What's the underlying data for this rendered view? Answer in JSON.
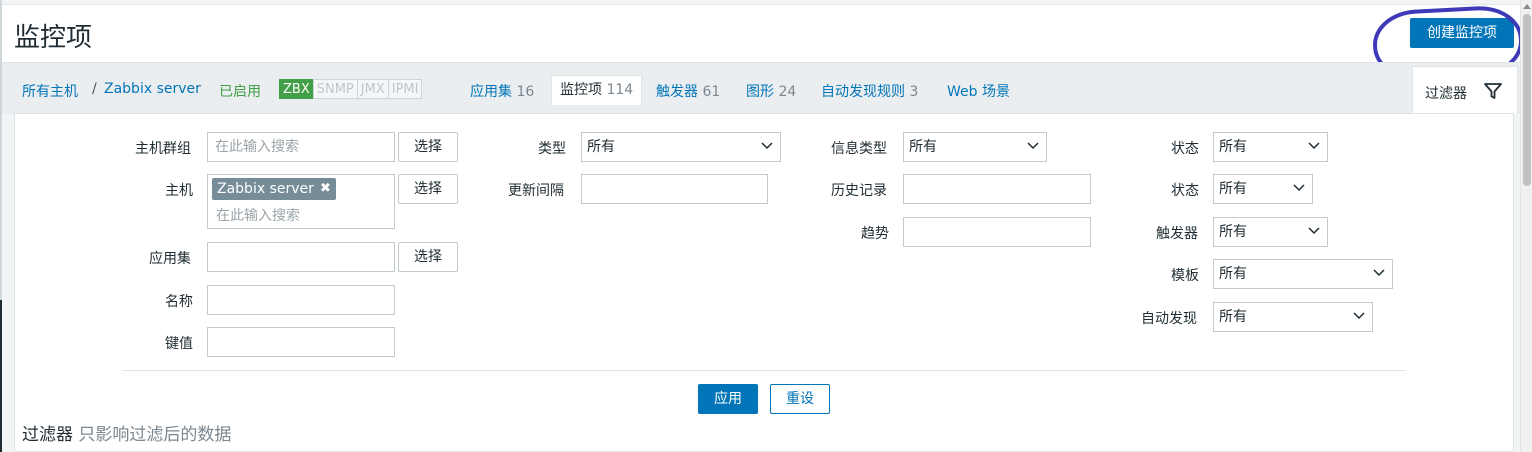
{
  "header": {
    "title": "监控项",
    "create_button": "创建监控项"
  },
  "breadcrumb": {
    "all_hosts": "所有主机",
    "separator": "/",
    "host": "Zabbix server",
    "status": "已启用"
  },
  "availability": [
    "ZBX",
    "SNMP",
    "JMX",
    "IPMI"
  ],
  "tabs": {
    "applications": {
      "label": "应用集",
      "count": "16"
    },
    "items": {
      "label": "监控项",
      "count": "114"
    },
    "triggers": {
      "label": "触发器",
      "count": "61"
    },
    "graphs": {
      "label": "图形",
      "count": "24"
    },
    "discovery": {
      "label": "自动发现规则",
      "count": "3"
    },
    "web": {
      "label": "Web 场景"
    }
  },
  "filter_tab": {
    "label": "过滤器"
  },
  "filter": {
    "host_group": {
      "label": "主机群组",
      "placeholder": "在此输入搜索",
      "button": "选择"
    },
    "host": {
      "label": "主机",
      "tag": "Zabbix server",
      "tag_remove": "✖",
      "placeholder": "在此输入搜索",
      "button": "选择"
    },
    "application": {
      "label": "应用集",
      "value": "",
      "button": "选择"
    },
    "name": {
      "label": "名称",
      "value": ""
    },
    "key": {
      "label": "键值",
      "value": ""
    },
    "type": {
      "label": "类型",
      "value": "所有"
    },
    "update_interval": {
      "label": "更新间隔",
      "value": ""
    },
    "info_type": {
      "label": "信息类型",
      "value": "所有"
    },
    "history": {
      "label": "历史记录",
      "value": ""
    },
    "trends": {
      "label": "趋势",
      "value": ""
    },
    "state": {
      "label": "状态",
      "value": "所有"
    },
    "status": {
      "label": "状态",
      "value": "所有"
    },
    "triggers": {
      "label": "触发器",
      "value": "所有"
    },
    "template": {
      "label": "模板",
      "value": "所有"
    },
    "discovery": {
      "label": "自动发现",
      "value": "所有"
    },
    "apply_button": "应用",
    "reset_button": "重设"
  },
  "footer": {
    "title": "过滤器",
    "subtitle": "只影响过滤后的数据"
  },
  "colors": {
    "primary": "#0275b8",
    "enabled": "#429e47",
    "annotation": "#3d39b8"
  }
}
